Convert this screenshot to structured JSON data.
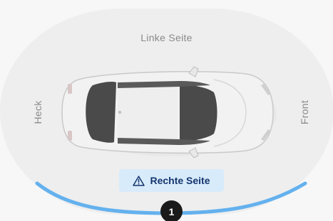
{
  "labels": {
    "left_side": "Linke Seite",
    "rear": "Heck",
    "front": "Front"
  },
  "selected_side": {
    "label": "Rechte Seite",
    "icon": "warning-triangle-icon"
  },
  "marker": {
    "number": "1"
  },
  "colors": {
    "background": "#f7f7f7",
    "ring": "#eeeeee",
    "highlight_arc": "#64b1ee",
    "badge_bg": "#d8ebfb",
    "badge_text": "#14356f",
    "marker_bg": "#1a1a1a"
  }
}
